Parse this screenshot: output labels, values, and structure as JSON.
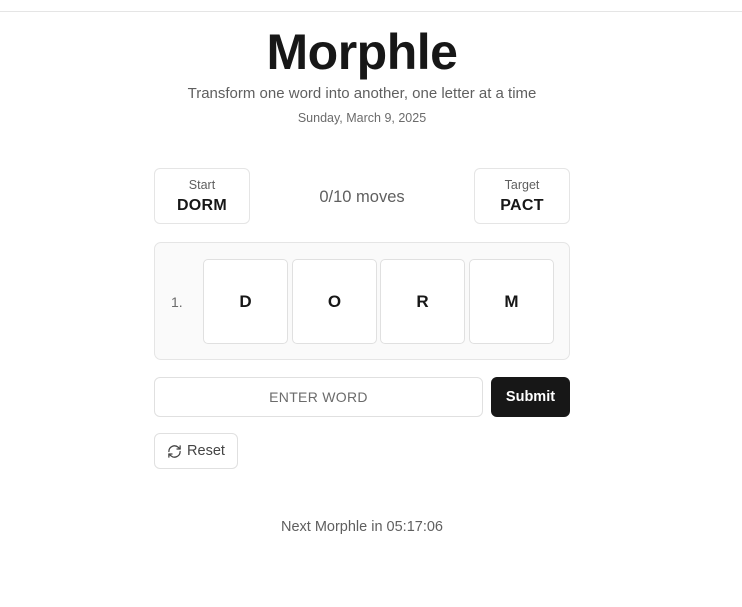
{
  "header": {
    "title": "Morphle",
    "subtitle": "Transform one word into another, one letter at a time",
    "date": "Sunday, March 9, 2025"
  },
  "start": {
    "label": "Start",
    "word": "DORM"
  },
  "target": {
    "label": "Target",
    "word": "PACT"
  },
  "moves_text": "0/10 moves",
  "board": {
    "rows": [
      {
        "number": "1.",
        "letters": [
          "D",
          "O",
          "R",
          "M"
        ]
      }
    ]
  },
  "input": {
    "placeholder": "ENTER WORD",
    "value": ""
  },
  "submit_label": "Submit",
  "reset": {
    "label": "Reset",
    "icon": "refresh-icon"
  },
  "next_text": "Next Morphle in 05:17:06",
  "colors": {
    "primary": "#171717",
    "muted_text": "#5f5f5f",
    "border": "#e5e5e5",
    "board_bg": "#fafafa"
  }
}
